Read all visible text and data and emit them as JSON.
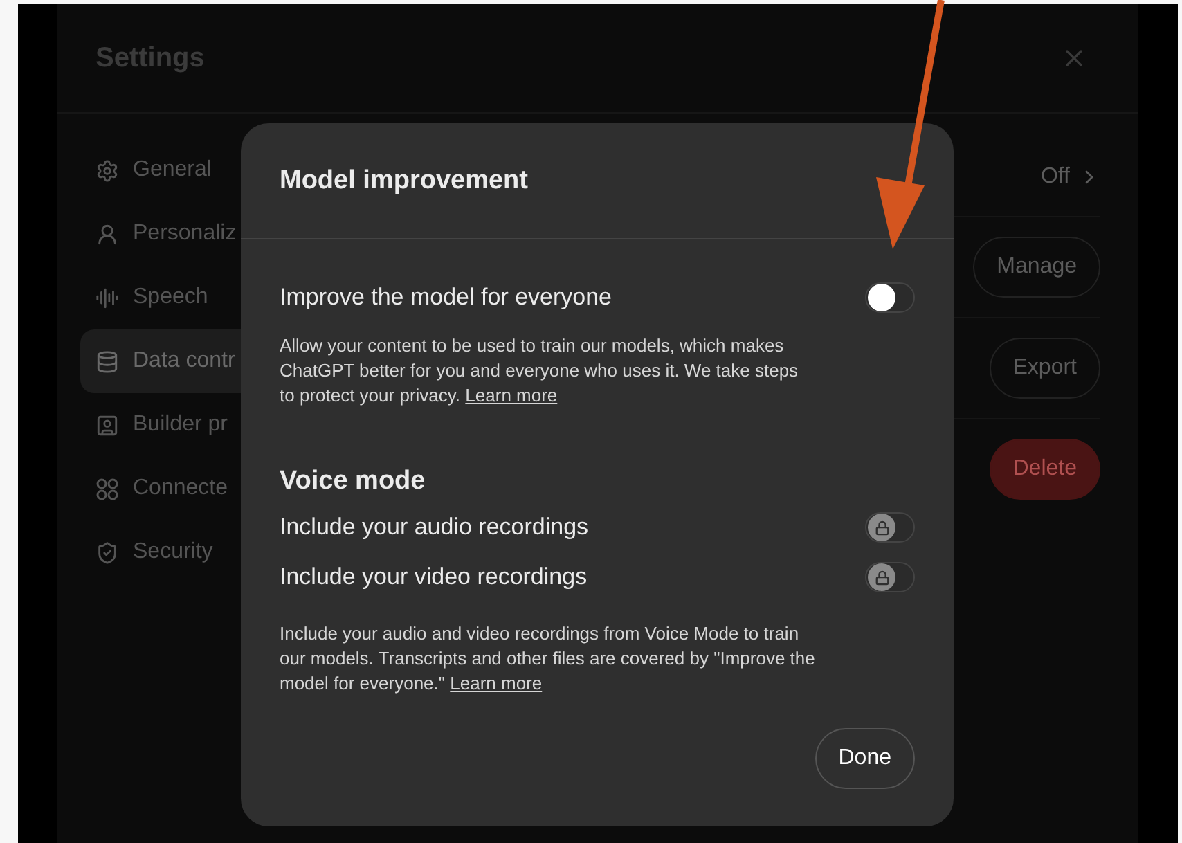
{
  "settings": {
    "title": "Settings",
    "nav": [
      {
        "label": "General",
        "selected": false
      },
      {
        "label": "Personaliz",
        "selected": false
      },
      {
        "label": "Speech",
        "selected": false
      },
      {
        "label": "Data contr",
        "selected": true
      },
      {
        "label": "Builder pr",
        "selected": false
      },
      {
        "label": "Connecte",
        "selected": false
      },
      {
        "label": "Security",
        "selected": false
      }
    ],
    "rows": [
      {
        "kind": "value",
        "text": "Off"
      },
      {
        "kind": "button",
        "text": "Manage"
      },
      {
        "kind": "button",
        "text": "Export"
      },
      {
        "kind": "danger",
        "text": "Delete"
      }
    ]
  },
  "dialog": {
    "title": "Model improvement",
    "main": {
      "label": "Improve the model for everyone",
      "on": false,
      "description": "Allow your content to be used to train our models, which makes ChatGPT better for you and everyone who uses it. We take steps to protect your privacy.",
      "link": "Learn more"
    },
    "section_title": "Voice mode",
    "voice": [
      {
        "label": "Include your audio recordings",
        "on": false,
        "locked": true
      },
      {
        "label": "Include your video recordings",
        "on": false,
        "locked": true
      }
    ],
    "voice_description": "Include your audio and video recordings from Voice Mode to train our models. Transcripts and other files are covered by \"Improve the model for everyone.\"",
    "voice_link": "Learn more",
    "button": "Done"
  }
}
